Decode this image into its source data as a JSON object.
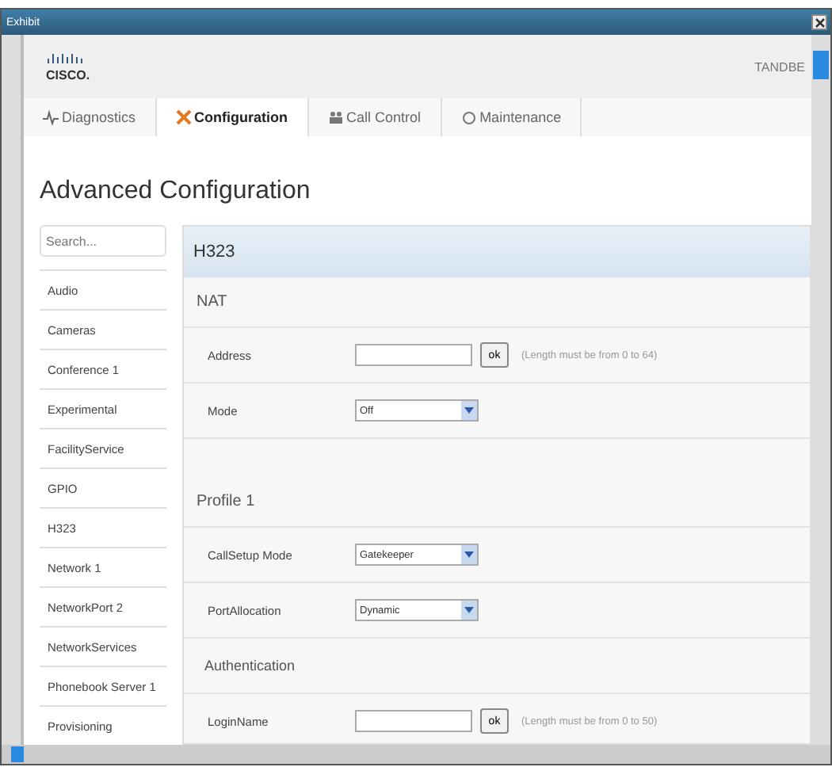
{
  "window": {
    "title": "Exhibit"
  },
  "header": {
    "logo_text": "CISCO.",
    "device": "TANDBE"
  },
  "tabs": [
    {
      "label": "Diagnostics",
      "selected": false
    },
    {
      "label": "Configuration",
      "selected": true
    },
    {
      "label": "Call Control",
      "selected": false
    },
    {
      "label": "Maintenance",
      "selected": false
    }
  ],
  "page_title": "Advanced Configuration",
  "search": {
    "placeholder": "Search..."
  },
  "sidebar": {
    "items": [
      {
        "label": "Audio",
        "selected": false
      },
      {
        "label": "Cameras",
        "selected": false
      },
      {
        "label": "Conference 1",
        "selected": false
      },
      {
        "label": "Experimental",
        "selected": false
      },
      {
        "label": "FacilityService",
        "selected": false
      },
      {
        "label": "GPIO",
        "selected": false
      },
      {
        "label": "H323",
        "selected": false
      },
      {
        "label": "Network 1",
        "selected": false
      },
      {
        "label": "NetworkPort 2",
        "selected": false
      },
      {
        "label": "NetworkServices",
        "selected": false
      },
      {
        "label": "Phonebook Server 1",
        "selected": false
      },
      {
        "label": "Provisioning",
        "selected": false
      }
    ]
  },
  "panel": {
    "title": "H323",
    "sections": [
      {
        "title": "NAT",
        "rows": [
          {
            "kind": "text",
            "label": "Address",
            "button": "ok",
            "hint": "(Length must be from 0 to 64)"
          },
          {
            "kind": "select",
            "label": "Mode",
            "value": "Off"
          }
        ]
      },
      {
        "title": "Profile 1",
        "rows": [
          {
            "kind": "select",
            "label": "CallSetup Mode",
            "value": "Gatekeeper"
          },
          {
            "kind": "select",
            "label": "PortAllocation",
            "value": "Dynamic"
          },
          {
            "kind": "heading",
            "label": "Authentication"
          },
          {
            "kind": "text",
            "label": "LoginName",
            "button": "ok",
            "hint": "(Length must be from 0 to 50)"
          }
        ]
      }
    ]
  }
}
